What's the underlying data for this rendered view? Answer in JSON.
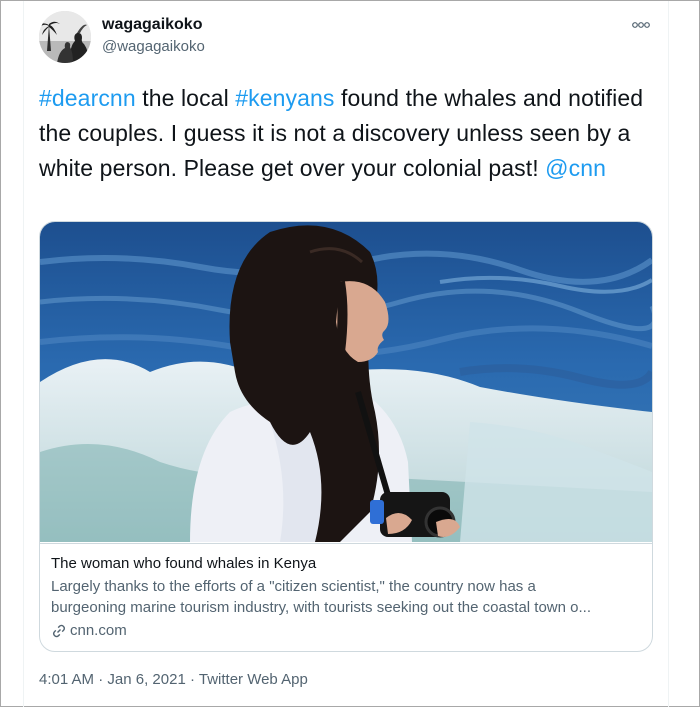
{
  "user": {
    "display_name": "wagagaikoko",
    "handle": "@wagagaikoko",
    "avatar_icon": "avatar-beach-silhouette"
  },
  "more_icon": "more-options-icon",
  "tweet": {
    "segments": [
      {
        "text": "#dearcnn",
        "type": "hashtag"
      },
      {
        "text": " the local ",
        "type": "text"
      },
      {
        "text": "#kenyans",
        "type": "hashtag"
      },
      {
        "text": " found the whales and notified the couples. I guess it is not a discovery unless seen by a white person. Please get over your colonial past! ",
        "type": "text"
      },
      {
        "text": "@cnn",
        "type": "mention"
      }
    ]
  },
  "card": {
    "title": "The woman who found whales in Kenya",
    "description_line1": "Largely thanks to the efforts of a \"citizen scientist,\" the country now has a",
    "description_line2": "burgeoning marine tourism industry, with tourists seeking out the coastal town o...",
    "domain": "cnn.com",
    "image_alt_icon": "woman-on-boat-photo"
  },
  "meta": {
    "time": "4:01 AM",
    "separator1": " · ",
    "date": "Jan 6, 2021",
    "separator2": " · ",
    "source": "Twitter Web App"
  },
  "colors": {
    "link": "#1d9bf0",
    "text": "#0f1419",
    "secondary": "#536471",
    "border": "#cfd9de"
  }
}
